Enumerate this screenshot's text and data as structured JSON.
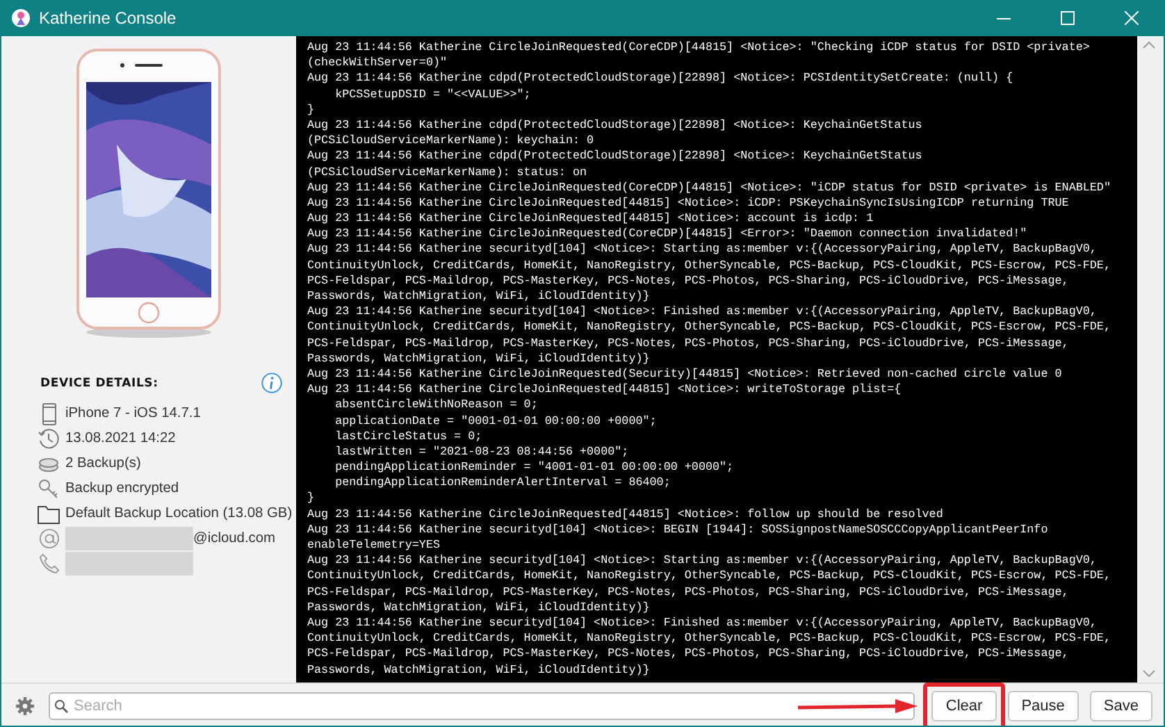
{
  "window": {
    "title": "Katherine Console"
  },
  "device_details": {
    "heading": "DEVICE DETAILS:",
    "items": [
      {
        "kind": "device",
        "text": "iPhone 7 - iOS 14.7.1"
      },
      {
        "kind": "date",
        "text": "13.08.2021 14:22"
      },
      {
        "kind": "backups",
        "text": "2 Backup(s)"
      },
      {
        "kind": "encrypted",
        "text": "Backup encrypted"
      },
      {
        "kind": "folder",
        "text": "Default Backup Location (13.08 GB)"
      },
      {
        "kind": "email",
        "text": "@icloud.com"
      },
      {
        "kind": "phone"
      }
    ]
  },
  "console_lines": [
    "Aug 23 11:44:56 Katherine CircleJoinRequested(CoreCDP)[44815] <Notice>: \"Checking iCDP status for DSID <private>",
    "(checkWithServer=0)\"",
    "Aug 23 11:44:56 Katherine cdpd(ProtectedCloudStorage)[22898] <Notice>: PCSIdentitySetCreate: (null) {",
    "    kPCSSetupDSID = \"<<VALUE>>\";",
    "}",
    "Aug 23 11:44:56 Katherine cdpd(ProtectedCloudStorage)[22898] <Notice>: KeychainGetStatus",
    "(PCSiCloudServiceMarkerName): keychain: 0",
    "Aug 23 11:44:56 Katherine cdpd(ProtectedCloudStorage)[22898] <Notice>: KeychainGetStatus",
    "(PCSiCloudServiceMarkerName): status: on",
    "Aug 23 11:44:56 Katherine CircleJoinRequested(CoreCDP)[44815] <Notice>: \"iCDP status for DSID <private> is ENABLED\"",
    "Aug 23 11:44:56 Katherine CircleJoinRequested[44815] <Notice>: iCDP: PSKeychainSyncIsUsingICDP returning TRUE",
    "Aug 23 11:44:56 Katherine CircleJoinRequested[44815] <Notice>: account is icdp: 1",
    "Aug 23 11:44:56 Katherine CircleJoinRequested(CoreCDP)[44815] <Error>: \"Daemon connection invalidated!\"",
    "Aug 23 11:44:56 Katherine securityd[104] <Notice>: Starting as:member v:{(AccessoryPairing, AppleTV, BackupBagV0,",
    "ContinuityUnlock, CreditCards, HomeKit, NanoRegistry, OtherSyncable, PCS-Backup, PCS-CloudKit, PCS-Escrow, PCS-FDE,",
    "PCS-Feldspar, PCS-Maildrop, PCS-MasterKey, PCS-Notes, PCS-Photos, PCS-Sharing, PCS-iCloudDrive, PCS-iMessage,",
    "Passwords, WatchMigration, WiFi, iCloudIdentity)}",
    "Aug 23 11:44:56 Katherine securityd[104] <Notice>: Finished as:member v:{(AccessoryPairing, AppleTV, BackupBagV0,",
    "ContinuityUnlock, CreditCards, HomeKit, NanoRegistry, OtherSyncable, PCS-Backup, PCS-CloudKit, PCS-Escrow, PCS-FDE,",
    "PCS-Feldspar, PCS-Maildrop, PCS-MasterKey, PCS-Notes, PCS-Photos, PCS-Sharing, PCS-iCloudDrive, PCS-iMessage,",
    "Passwords, WatchMigration, WiFi, iCloudIdentity)}",
    "Aug 23 11:44:56 Katherine CircleJoinRequested(Security)[44815] <Notice>: Retrieved non-cached circle value 0",
    "Aug 23 11:44:56 Katherine CircleJoinRequested[44815] <Notice>: writeToStorage plist={",
    "    absentCircleWithNoReason = 0;",
    "    applicationDate = \"0001-01-01 00:00:00 +0000\";",
    "    lastCircleStatus = 0;",
    "    lastWritten = \"2021-08-23 08:44:56 +0000\";",
    "    pendingApplicationReminder = \"4001-01-01 00:00:00 +0000\";",
    "    pendingApplicationReminderAlertInterval = 86400;",
    "}",
    "Aug 23 11:44:56 Katherine CircleJoinRequested[44815] <Notice>: follow up should be resolved",
    "Aug 23 11:44:56 Katherine securityd[104] <Notice>: BEGIN [1944]: SOSSignpostNameSOSCCCopyApplicantPeerInfo",
    "enableTelemetry=YES",
    "Aug 23 11:44:56 Katherine securityd[104] <Notice>: Starting as:member v:{(AccessoryPairing, AppleTV, BackupBagV0,",
    "ContinuityUnlock, CreditCards, HomeKit, NanoRegistry, OtherSyncable, PCS-Backup, PCS-CloudKit, PCS-Escrow, PCS-FDE,",
    "PCS-Feldspar, PCS-Maildrop, PCS-MasterKey, PCS-Notes, PCS-Photos, PCS-Sharing, PCS-iCloudDrive, PCS-iMessage,",
    "Passwords, WatchMigration, WiFi, iCloudIdentity)}",
    "Aug 23 11:44:56 Katherine securityd[104] <Notice>: Finished as:member v:{(AccessoryPairing, AppleTV, BackupBagV0,",
    "ContinuityUnlock, CreditCards, HomeKit, NanoRegistry, OtherSyncable, PCS-Backup, PCS-CloudKit, PCS-Escrow, PCS-FDE,",
    "PCS-Feldspar, PCS-Maildrop, PCS-MasterKey, PCS-Notes, PCS-Photos, PCS-Sharing, PCS-iCloudDrive, PCS-iMessage,",
    "Passwords, WatchMigration, WiFi, iCloudIdentity)}"
  ],
  "search": {
    "placeholder": "Search"
  },
  "buttons": [
    {
      "label": "Clear",
      "highlighted": true
    },
    {
      "label": "Pause",
      "highlighted": false
    },
    {
      "label": "Save",
      "highlighted": false
    }
  ]
}
